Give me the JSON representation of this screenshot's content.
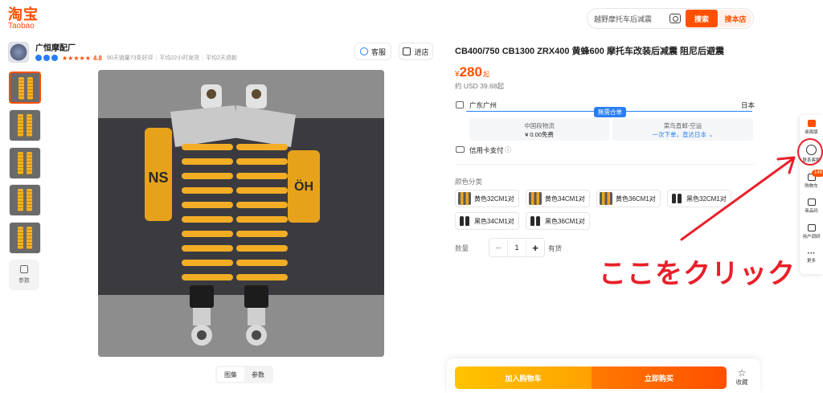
{
  "header": {
    "logo_cn": "淘宝",
    "logo_en": "Taobao",
    "search_placeholder": "越野摩托车后减震",
    "search_button": "搜索",
    "search_store_button": "搜本店"
  },
  "shop": {
    "name": "广恒摩配厂",
    "rating": "4.8",
    "stats": [
      "90天销量73条好评",
      "平均22小时发货",
      "平均2天退款"
    ],
    "service_button": "客服",
    "enter_shop_button": "进店"
  },
  "gallery": {
    "param_thumb_label": "参数",
    "tabs": [
      "图集",
      "参数"
    ]
  },
  "product": {
    "title": "CB400/750 CB1300 ZRX400 黄蜂600 摩托车改装后减震 阻尼后避震",
    "currency": "¥",
    "price": "280",
    "price_suffix": "起",
    "usd_price": "约 USD 39.68起",
    "shipping": {
      "from": "广东广州",
      "to": "日本",
      "badge": "無需合单",
      "box1_line1": "中国段物流",
      "box1_line2": "¥ 0.00免费",
      "box2_line1": "菜鸟直邮-空运",
      "box2_line2": "一次下单，直达日本"
    },
    "payment": "信用卡支付",
    "color_label": "颜色分类",
    "options": [
      {
        "label": "黄色32CM1对",
        "swatch": "yellow"
      },
      {
        "label": "黄色34CM1对",
        "swatch": "yellow"
      },
      {
        "label": "黄色36CM1对",
        "swatch": "yellow"
      },
      {
        "label": "黑色32CM1对",
        "swatch": "black"
      },
      {
        "label": "黑色34CM1对",
        "swatch": "black"
      },
      {
        "label": "黑色36CM1对",
        "swatch": "black"
      }
    ],
    "quantity_label": "数量",
    "quantity": "1",
    "stock": "有货"
  },
  "actions": {
    "add_to_cart": "加入购物车",
    "buy_now": "立即购买",
    "favorite": "收藏"
  },
  "sidebar": {
    "items": [
      "桌面版",
      "联系客服",
      "购物车",
      "商品码",
      "用户调研",
      "更多"
    ],
    "cart_count": "146"
  },
  "annotation": {
    "text": "ここをクリック"
  },
  "colors": {
    "brand_orange": "#ff5000",
    "link_blue": "#2a7ef5",
    "annotation_red": "#e8202a"
  }
}
